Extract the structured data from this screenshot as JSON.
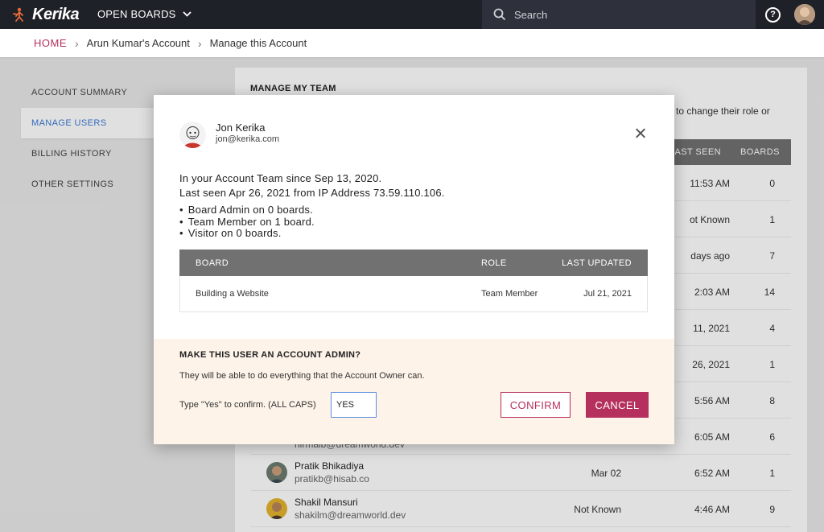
{
  "topbar": {
    "logo_text": "Kerika",
    "boards_menu_label": "OPEN BOARDS",
    "search_placeholder": "Search"
  },
  "breadcrumb": {
    "home": "HOME",
    "account": "Arun Kumar's Account",
    "current": "Manage this Account"
  },
  "sidenav": {
    "items": [
      {
        "label": "ACCOUNT SUMMARY"
      },
      {
        "label": "MANAGE USERS"
      },
      {
        "label": "BILLING HISTORY"
      },
      {
        "label": "OTHER SETTINGS"
      }
    ]
  },
  "team": {
    "title": "MANAGE MY TEAM",
    "hint_visible": "to change their role or",
    "columns": {
      "last_seen": "LAST SEEN",
      "boards": "BOARDS"
    },
    "rows": [
      {
        "last_seen": "11:53 AM",
        "boards": "0"
      },
      {
        "last_seen": "ot Known",
        "boards": "1"
      },
      {
        "last_seen": "days ago",
        "boards": "7"
      },
      {
        "last_seen": "2:03 AM",
        "boards": "14"
      },
      {
        "last_seen": "11, 2021",
        "boards": "4"
      },
      {
        "last_seen": "26, 2021",
        "boards": "1"
      },
      {
        "last_seen": "5:56 AM",
        "boards": "8"
      },
      {
        "email": "nirmalb@dreamworld.dev",
        "last_seen": "6:05 AM",
        "boards": "6"
      },
      {
        "name": "Pratik Bhikadiya",
        "email": "pratikb@hisab.co",
        "account_date": "Mar 02",
        "last_seen": "6:52 AM",
        "boards": "1"
      },
      {
        "name": "Shakil Mansuri",
        "email": "shakilm@dreamworld.dev",
        "account_date": "Not Known",
        "last_seen": "4:46 AM",
        "boards": "9"
      }
    ]
  },
  "modal": {
    "user_name": "Jon Kerika",
    "user_email": "jon@kerika.com",
    "since": "In your Account Team since Sep 13, 2020.",
    "last_seen": "Last seen Apr 26, 2021 from IP Address 73.59.110.106.",
    "roles": [
      "Board Admin on 0 boards.",
      "Team Member on 1 board.",
      "Visitor on 0 boards."
    ],
    "table": {
      "headers": {
        "board": "BOARD",
        "role": "ROLE",
        "updated": "LAST UPDATED"
      },
      "rows": [
        {
          "board": "Building a Website",
          "role": "Team Member",
          "updated": "Jul 21, 2021"
        }
      ]
    },
    "admin": {
      "title": "MAKE THIS USER AN ACCOUNT ADMIN?",
      "description": "They will be able to do everything that the Account Owner can.",
      "confirm_label": "Type \"Yes\" to confirm. (ALL CAPS)",
      "input_value": "YES",
      "confirm_button": "CONFIRM",
      "cancel_button": "CANCEL"
    }
  },
  "colors": {
    "accent": "#b5305c",
    "active_nav": "#3c7bd6",
    "topbar": "#1f2129",
    "admin_bg": "#fdf3e9"
  }
}
